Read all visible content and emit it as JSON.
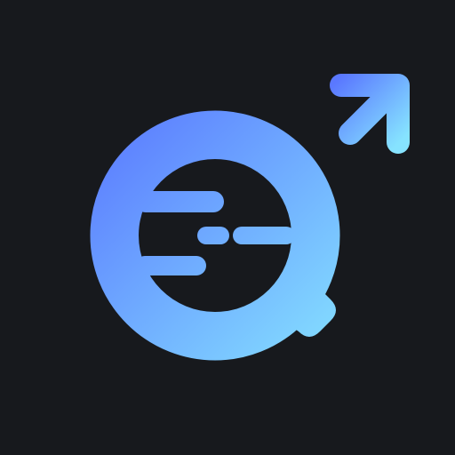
{
  "app_icon": {
    "background_color": "#17191d",
    "gradient_start_color": "#5a78ff",
    "gradient_end_color": "#86e3ff",
    "icons": [
      "search-magnifier-icon",
      "speed-lines-icon",
      "arrow-up-right-icon"
    ]
  }
}
